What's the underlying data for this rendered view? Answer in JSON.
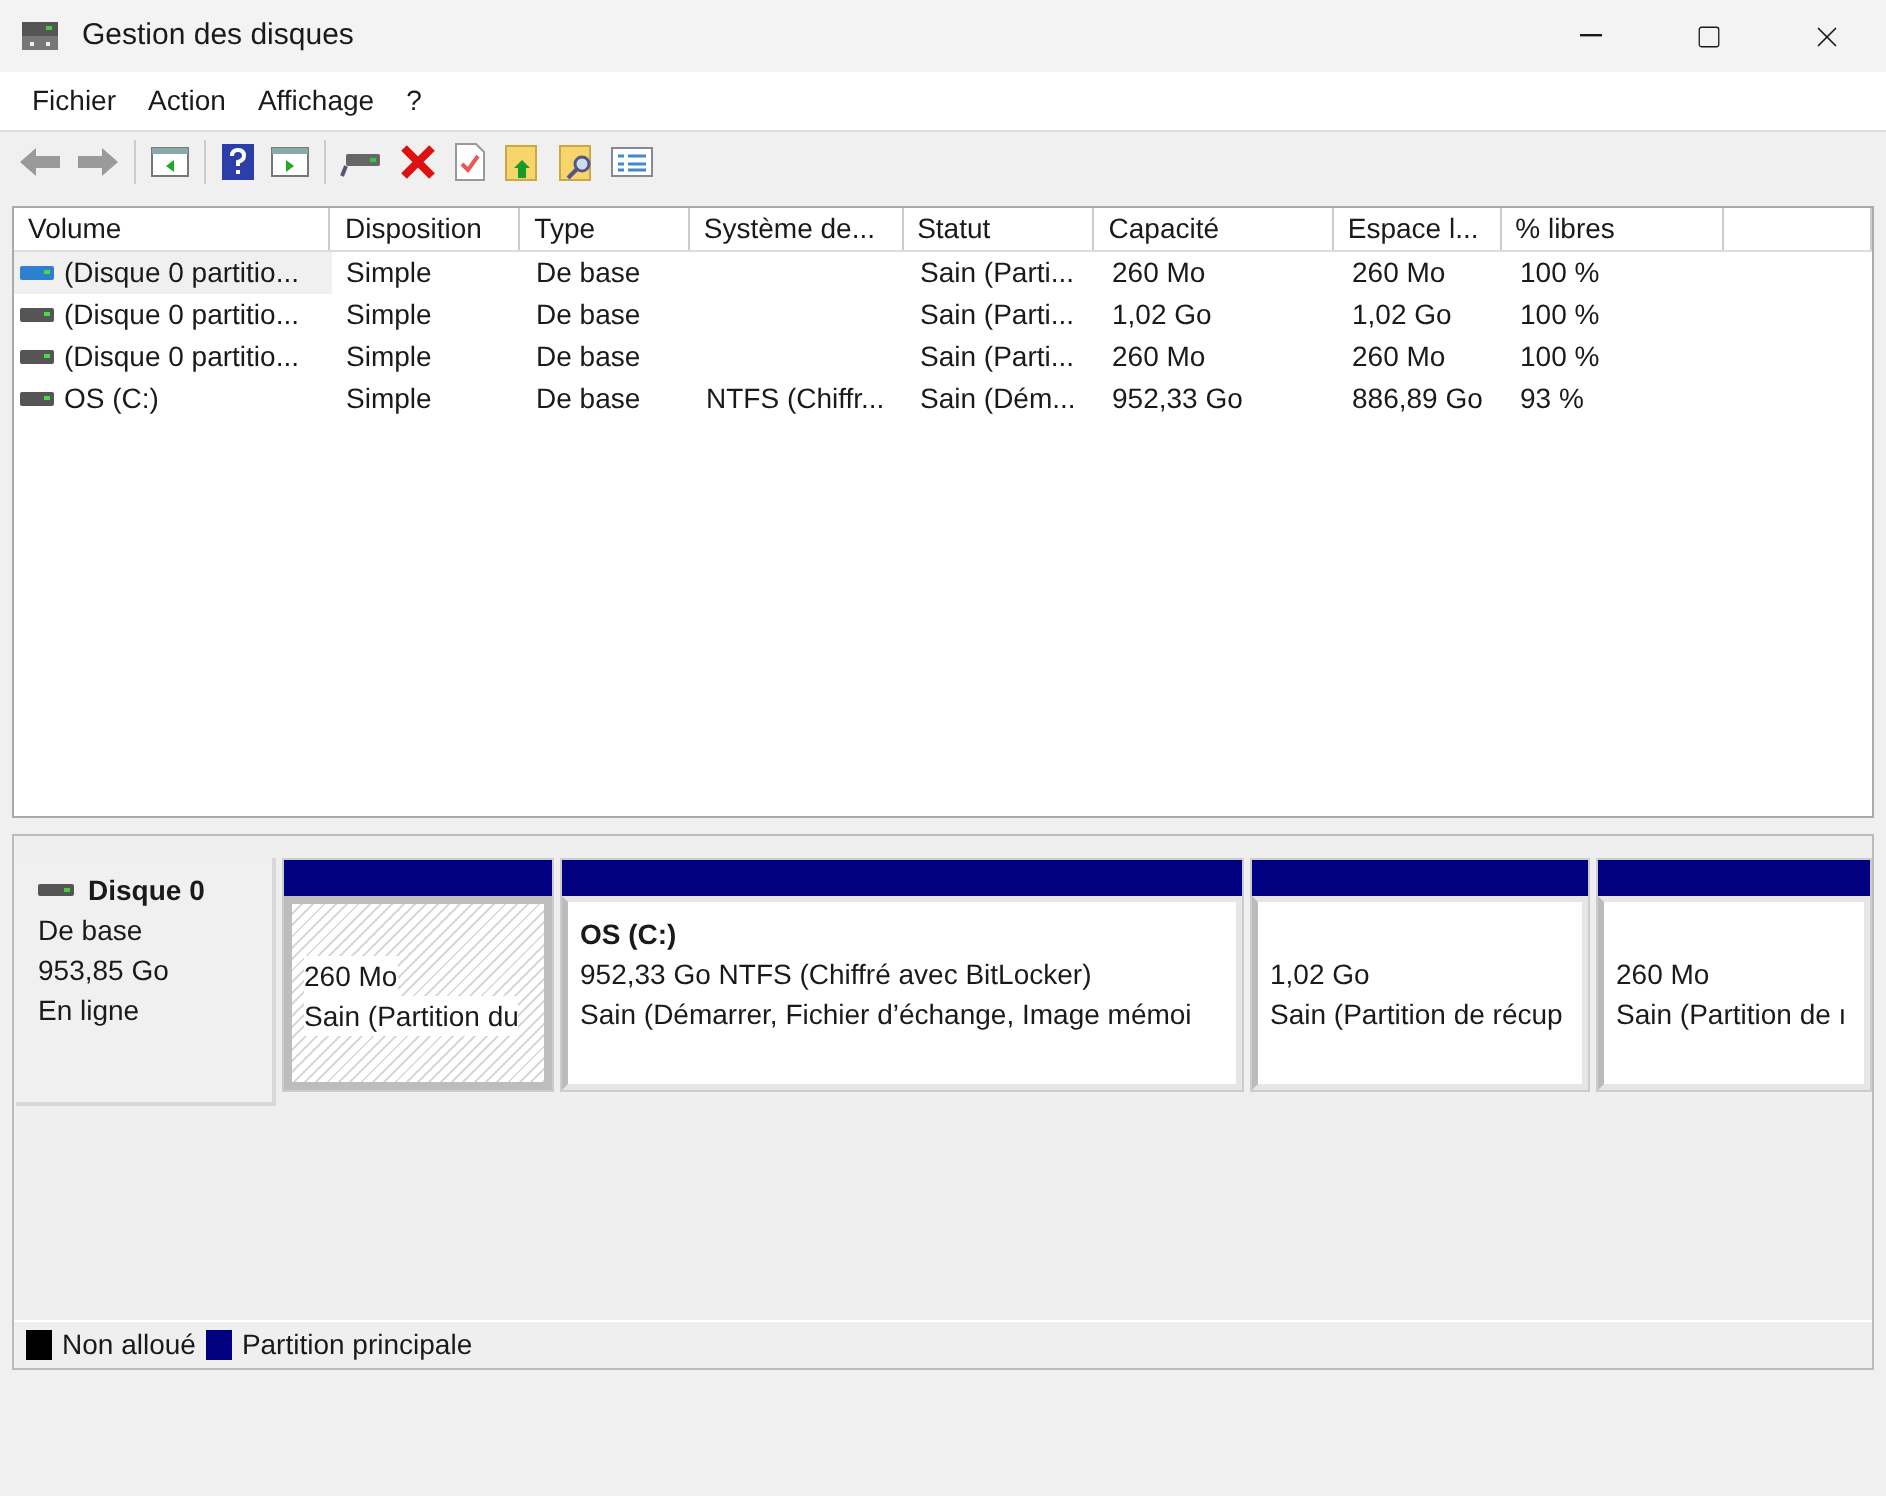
{
  "window": {
    "title": "Gestion des disques"
  },
  "menu": [
    "Fichier",
    "Action",
    "Affichage",
    "?"
  ],
  "toolbar": [
    {
      "kind": "back",
      "disabled": true
    },
    {
      "kind": "forward",
      "disabled": true
    },
    {
      "kind": "panel"
    },
    {
      "kind": "help"
    },
    {
      "kind": "panel2"
    },
    {
      "kind": "drive"
    },
    {
      "kind": "delete"
    },
    {
      "kind": "check"
    },
    {
      "kind": "folder-up"
    },
    {
      "kind": "folder-search"
    },
    {
      "kind": "list"
    }
  ],
  "table": {
    "columns": [
      "Volume",
      "Disposition",
      "Type",
      "Système de...",
      "Statut",
      "Capacité",
      "Espace l...",
      "% libres"
    ],
    "rows": [
      {
        "selected": true,
        "cells": [
          "(Disque 0 partitio...",
          "Simple",
          "De base",
          "",
          "Sain (Parti...",
          "260 Mo",
          "260 Mo",
          "100 %"
        ]
      },
      {
        "selected": false,
        "cells": [
          "(Disque 0 partitio...",
          "Simple",
          "De base",
          "",
          "Sain (Parti...",
          "1,02 Go",
          "1,02 Go",
          "100 %"
        ]
      },
      {
        "selected": false,
        "cells": [
          "(Disque 0 partitio...",
          "Simple",
          "De base",
          "",
          "Sain (Parti...",
          "260 Mo",
          "260 Mo",
          "100 %"
        ]
      },
      {
        "selected": false,
        "cells": [
          "OS (C:)",
          "Simple",
          "De base",
          "NTFS (Chiffr...",
          "Sain (Dém...",
          "952,33 Go",
          "886,89 Go",
          "93 %"
        ]
      }
    ]
  },
  "disk": {
    "name": "Disque 0",
    "type": "De base",
    "size": "953,85 Go",
    "status": "En ligne",
    "partitions": [
      {
        "selected": true,
        "lines": [
          "260 Mo",
          "Sain (Partition du"
        ]
      },
      {
        "selected": false,
        "title": "OS  (C:)",
        "lines": [
          "952,33 Go NTFS (Chiffré avec BitLocker)",
          "Sain (Démarrer, Fichier d’échange, Image mémoi"
        ]
      },
      {
        "selected": false,
        "lines": [
          "1,02 Go",
          "Sain (Partition de récup"
        ]
      },
      {
        "selected": false,
        "lines": [
          "260 Mo",
          "Sain (Partition de ı"
        ]
      }
    ]
  },
  "legend": [
    {
      "label": "Non alloué",
      "color": "#000000"
    },
    {
      "label": "Partition principale",
      "color": "#000080"
    }
  ]
}
